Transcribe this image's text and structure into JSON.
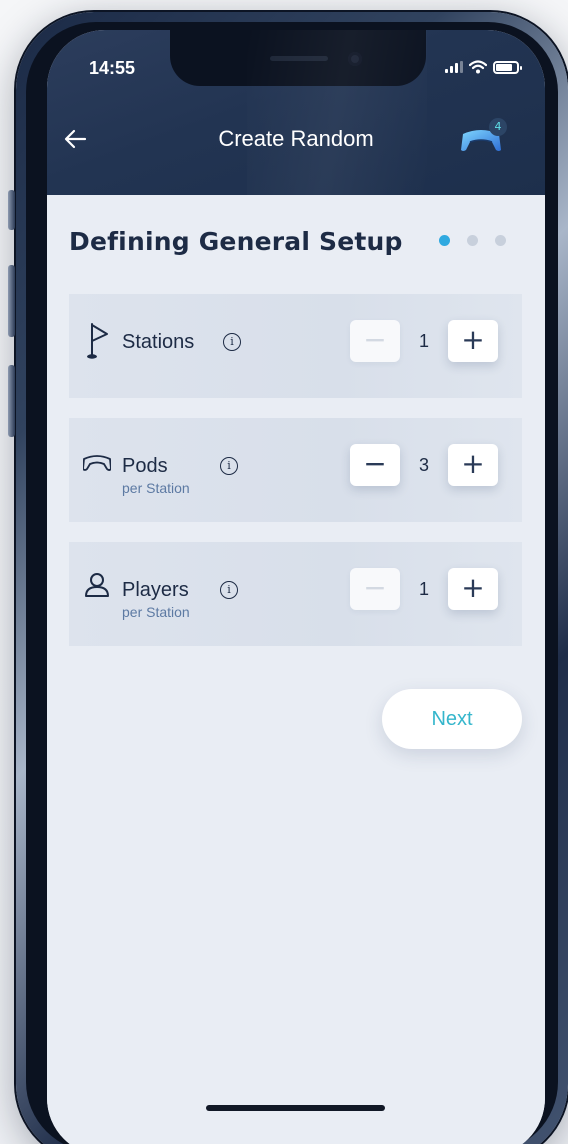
{
  "status_bar": {
    "time": "14:55",
    "icons": [
      "signal-icon",
      "wifi-icon",
      "battery-icon"
    ]
  },
  "header": {
    "back_icon": "arrow-left-icon",
    "title": "Create Random",
    "pod_icon": "pod-icon",
    "pod_badge": "4"
  },
  "page": {
    "title": "Defining General Setup",
    "steps": {
      "count": 3,
      "active": 1
    }
  },
  "settings": [
    {
      "label": "Stations",
      "sublabel": "",
      "icon": "flag-icon",
      "value": "1",
      "minus_enabled": false
    },
    {
      "label": "Pods",
      "sublabel": "per Station",
      "icon": "pod-icon",
      "value": "3",
      "minus_enabled": true
    },
    {
      "label": "Players",
      "sublabel": "per Station",
      "icon": "person-icon",
      "value": "1",
      "minus_enabled": false
    }
  ],
  "stepper": {
    "minus": "−",
    "plus": "+",
    "info": "i"
  },
  "actions": {
    "next_label": "Next"
  },
  "colors": {
    "header_bg": "#223452",
    "accent": "#35b6cc",
    "active_dot": "#2fa9e0",
    "row_bg": "#dde3ed"
  }
}
